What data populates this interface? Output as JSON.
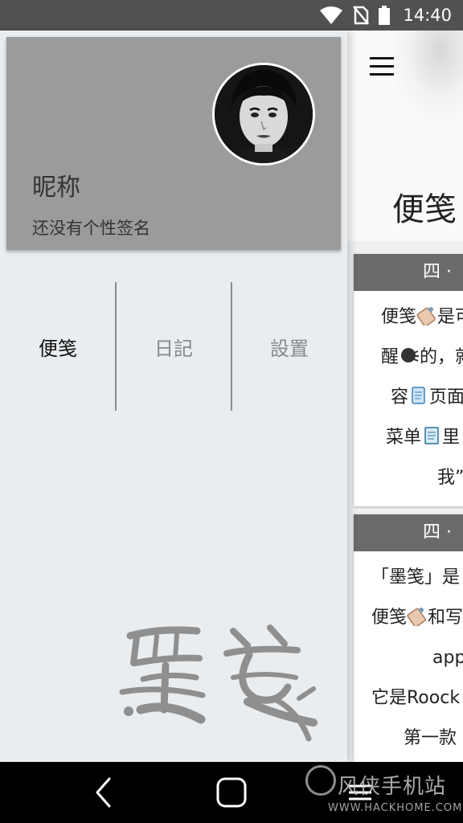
{
  "status_bar": {
    "time": "14:40"
  },
  "drawer": {
    "nickname": "昵称",
    "signature": "还没有个性签名",
    "tabs": [
      {
        "label": "便笺",
        "active": true
      },
      {
        "label": "日記",
        "active": false
      },
      {
        "label": "設置",
        "active": false
      }
    ]
  },
  "main": {
    "title": "便笺",
    "cards": [
      {
        "header": "四 · ",
        "lines": [
          {
            "text": "便笺",
            "emoji": "clipboard-icon",
            "text2": "是可"
          },
          {
            "text": "醒",
            "emoji": "speaking-head-icon",
            "text2": "的，就"
          },
          {
            "text": "容",
            "emoji": "scroll-icon",
            "text2": "页面"
          },
          {
            "text": "菜单",
            "emoji": "memo-icon",
            "text2": "里"
          },
          {
            "text": "我”",
            "emoji": "",
            "text2": ""
          }
        ]
      },
      {
        "header": "四 · ",
        "lines": [
          {
            "text": "「墨笺」是",
            "emoji": "",
            "text2": ""
          },
          {
            "text": "便笺",
            "emoji": "clipboard-icon",
            "text2": "和写"
          },
          {
            "text": "app",
            "emoji": "",
            "text2": ""
          },
          {
            "text": "它是Roock",
            "emoji": "",
            "text2": ""
          },
          {
            "text": "第一款",
            "emoji": "",
            "text2": ""
          }
        ]
      }
    ]
  },
  "watermark": {
    "title": "风侠手机站",
    "url": "WWW.HACKHOME.COM"
  },
  "colors": {
    "status_bar": "#515151",
    "profile_card": "#9b9b9b",
    "card_header": "#6b6b6b",
    "drawer_bg": "#e9edf0"
  }
}
